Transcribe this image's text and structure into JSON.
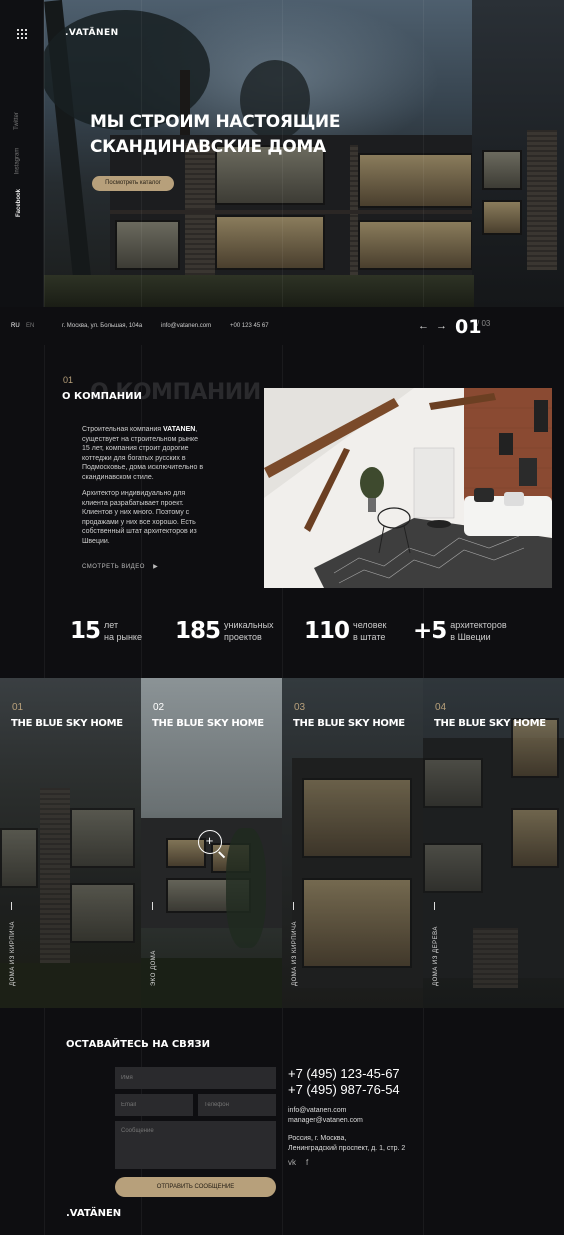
{
  "brand": {
    "logo": ".VATÄNEN",
    "footer_logo": ".VATÄNEN"
  },
  "side": {
    "socials": [
      "Twitter",
      "Instagram",
      "Facebook"
    ]
  },
  "hero": {
    "title_line1": "МЫ СТРОИМ НАСТОЯЩИЕ",
    "title_line2": "СКАНДИНАВСКИЕ ДОМА",
    "cta": "Посмотреть каталог"
  },
  "infobar": {
    "lang_ru": "RU",
    "lang_en": "EN",
    "address": "г. Москва, ул. Большая, 104а",
    "email": "info@vatanen.com",
    "phone": "+00 123 45 67",
    "arrows": "← →",
    "slide_current": "01",
    "slide_total": "/ 03"
  },
  "about": {
    "num": "01",
    "title": "О КОМПАНИИ",
    "ghost": "О КОМПАНИИ",
    "p1_a": "Строительная компания ",
    "p1_brand": "VATANEN",
    "p1_b": ", существует на строительном рынке 15 лет, компания строит дорогие коттеджи для богатых русских в Подмосковье, дома исключительно в скандинавском стиле.",
    "p2": "Архитектор индивидуально для клиента разрабатывает проект. Клиентов у них много. Поэтому с продажами у них все хорошо. Есть собственный штат архитекторов из Швеции.",
    "watch": "СМОТРЕТЬ ВИДЕО",
    "play_icon": "▶"
  },
  "stats": [
    {
      "num": "15",
      "l1": "лет",
      "l2": "на рынке"
    },
    {
      "num": "185",
      "l1": "уникальных",
      "l2": "проектов"
    },
    {
      "num": "110",
      "l1": "человек",
      "l2": "в штате"
    },
    {
      "num": "+5",
      "l1": "архитекторов",
      "l2": "в Швеции"
    }
  ],
  "cards": [
    {
      "num": "01",
      "title": "THE BLUE SKY HOME",
      "category": "ДОМА ИЗ КИРПИЧА"
    },
    {
      "num": "02",
      "title": "THE BLUE SKY HOME",
      "category": "ЭКО ДОМА"
    },
    {
      "num": "03",
      "title": "THE BLUE SKY HOME",
      "category": "ДОМА ИЗ КИРПИЧА"
    },
    {
      "num": "04",
      "title": "THE BLUE SKY HOME",
      "category": "ДОМА ИЗ ДЕРЕВА"
    }
  ],
  "contact": {
    "title": "ОСТАВАЙТЕСЬ НА СВЯЗИ",
    "name_placeholder": "Имя",
    "email_placeholder": "Email",
    "phone_placeholder": "Телефон",
    "message_placeholder": "Сообщение",
    "submit": "ОТПРАВИТЬ СООБЩЕНИЕ",
    "phone1": "+7 (495) 123-45-67",
    "phone2": "+7 (495) 987-76-54",
    "email1": "info@vatanen.com",
    "email2": "manager@vatanen.com",
    "addr1": "Россия, г. Москва,",
    "addr2": "Ленинградский проспект, д. 1, стр. 2",
    "vk": "vk",
    "fb": "f"
  },
  "colors": {
    "accent": "#b7a07b",
    "background": "#0e0e11"
  }
}
